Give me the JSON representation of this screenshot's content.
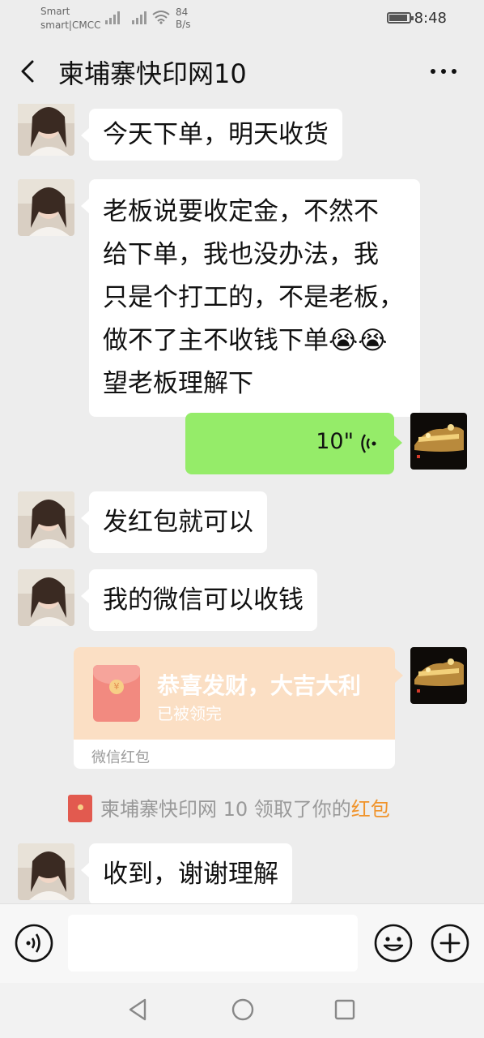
{
  "status_bar": {
    "carrier_line1": "Smart",
    "carrier_line2": "smart|CMCC",
    "net_speed_value": "84",
    "net_speed_unit": "B/s",
    "time": "8:48",
    "battery_level": 0.9
  },
  "header": {
    "title": "柬埔寨快印网10"
  },
  "messages": {
    "m1": "今天下单，明天收货",
    "m2_lines": [
      "老板说要收定金，不然不",
      "给下单，我也没办法，我",
      "只是个打工的，不是老板，",
      "做不了主不收钱下单😭😭",
      "望老板理解下"
    ],
    "voice_duration": "10\"",
    "m4": "发红包就可以",
    "m5": "我的微信可以收钱",
    "red_packet_title": "恭喜发财，大吉大利",
    "red_packet_status": "已被领完",
    "red_packet_label": "微信红包",
    "system_text": "柬埔寨快印网 10 领取了你的",
    "system_link": "红包",
    "m8": "收到，谢谢理解"
  },
  "colors": {
    "sent_bubble": "#95ec69",
    "red_packet_bg": "#fbdfc4",
    "link": "#f0932a",
    "background": "#ededed"
  },
  "icons": [
    "back-icon",
    "more-icon",
    "voice-wave-icon",
    "voice-mode-icon",
    "emoji-icon",
    "plus-icon",
    "nav-back-icon",
    "nav-home-icon",
    "nav-recent-icon"
  ]
}
